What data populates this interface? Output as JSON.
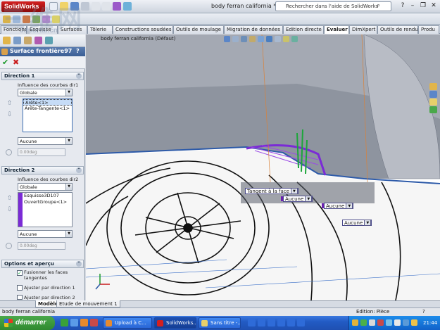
{
  "app": {
    "logo": "SolidWorks",
    "document_title": "body ferran california *"
  },
  "search": {
    "placeholder": "Rechercher dans l'aide de SolidWorks"
  },
  "tabs": [
    "Fonctions",
    "Esquisse",
    "Surfaces",
    "Tôlerie",
    "Constructions soudées",
    "Outils de moulage",
    "Migration de données",
    "Edition directe",
    "Evaluer",
    "DimXpert",
    "Outils de rendu",
    "Produ"
  ],
  "active_tab": "Evaluer",
  "feature": {
    "name": "Surface frontière97",
    "help": "?"
  },
  "direction1": {
    "header": "Direction 1",
    "influence_label": "Influence des courbes dir1",
    "influence_value": "Globale",
    "curves": [
      "Arête<1>",
      "Arête-Tangente<1>"
    ],
    "tangency": "Aucune",
    "angle": "0.00deg"
  },
  "direction2": {
    "header": "Direction 2",
    "influence_label": "Influence des courbes dir2",
    "influence_value": "Globale",
    "curves": [
      "Esquisse3D107",
      "OuvertGroupe<1>"
    ],
    "tangency": "Aucune",
    "angle": "0.00deg"
  },
  "options": {
    "header": "Options et aperçu",
    "merge_faces": "Fusionner les faces tangentes",
    "adjust_dir1": "Ajuster par direction 1",
    "adjust_dir2": "Ajuster par direction 2"
  },
  "viewport": {
    "tree_label": "body ferran california (Défaut)",
    "callouts": [
      "Tangent à la face",
      "Aucune",
      "Aucune",
      "Aucune"
    ]
  },
  "bottom_tabs": [
    "Modèle",
    "Etude de mouvement 1"
  ],
  "status": {
    "left": "body ferran california",
    "right": "Edition: Pièce",
    "help": "?"
  },
  "taskbar": {
    "start": "démarrer",
    "buttons": [
      "Upload à C...",
      "SolidWorks...",
      "Sans titre -..."
    ],
    "clock": "21:44"
  },
  "watermark": {
    "big": "三维网",
    "small": "3dportal.cn"
  },
  "colors": {
    "accent": "#3b5e94",
    "curve": "#7b2bd6",
    "taskbar": "#225bc4",
    "start": "#2f8a2f"
  }
}
